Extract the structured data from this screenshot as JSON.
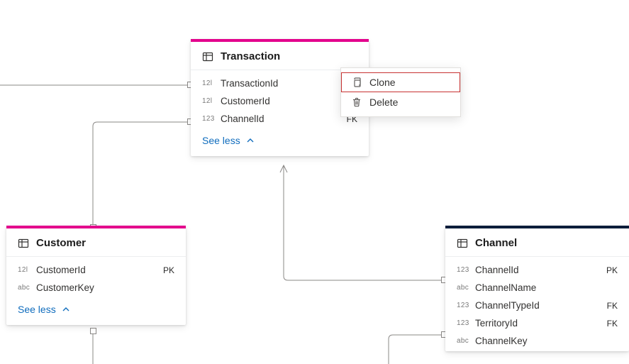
{
  "tables": {
    "transaction": {
      "title": "Transaction",
      "fields": [
        {
          "type": "12l",
          "name": "TransactionId",
          "key": ""
        },
        {
          "type": "12l",
          "name": "CustomerId",
          "key": ""
        },
        {
          "type": "123",
          "name": "ChannelId",
          "key": "FK"
        }
      ],
      "toggle_label": "See less",
      "accent": "pink"
    },
    "customer": {
      "title": "Customer",
      "fields": [
        {
          "type": "12l",
          "name": "CustomerId",
          "key": "PK"
        },
        {
          "type": "abc",
          "name": "CustomerKey",
          "key": ""
        }
      ],
      "toggle_label": "See less",
      "accent": "pink"
    },
    "channel": {
      "title": "Channel",
      "fields": [
        {
          "type": "123",
          "name": "ChannelId",
          "key": "PK"
        },
        {
          "type": "abc",
          "name": "ChannelName",
          "key": ""
        },
        {
          "type": "123",
          "name": "ChannelTypeId",
          "key": "FK"
        },
        {
          "type": "123",
          "name": "TerritoryId",
          "key": "FK"
        },
        {
          "type": "abc",
          "name": "ChannelKey",
          "key": ""
        }
      ],
      "accent": "dark"
    }
  },
  "context_menu": {
    "items": [
      {
        "id": "clone",
        "label": "Clone",
        "icon": "copy-icon",
        "highlighted": true
      },
      {
        "id": "delete",
        "label": "Delete",
        "icon": "trash-icon",
        "highlighted": false
      }
    ]
  }
}
